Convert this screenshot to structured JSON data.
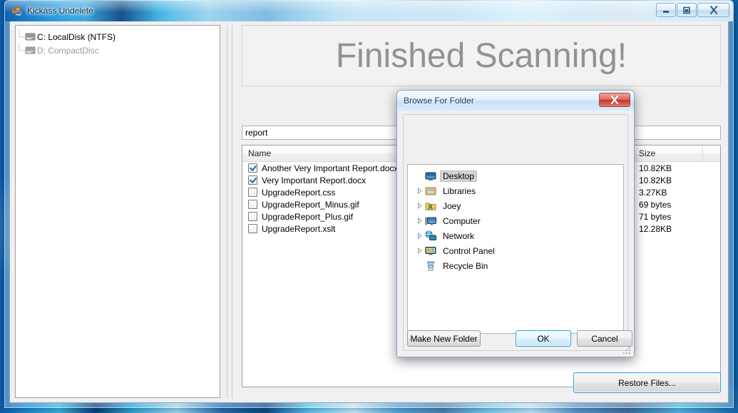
{
  "window": {
    "title": "Kickass Undelete",
    "icon": "app-icon",
    "minimize_label": "Minimize",
    "maximize_label": "Maximize",
    "close_label": "Close"
  },
  "drives": {
    "items": [
      {
        "label": "C: LocalDisk (NTFS)",
        "enabled": true
      },
      {
        "label": "D: CompactDisc",
        "enabled": false
      }
    ]
  },
  "banner": {
    "text": "Finished Scanning!"
  },
  "search": {
    "value": "report",
    "placeholder": ""
  },
  "filelist": {
    "columns": [
      "Name",
      "Size",
      ""
    ],
    "rows": [
      {
        "checked": true,
        "name": "Another Very Important Report.docx",
        "size": "10.82KB"
      },
      {
        "checked": true,
        "name": "Very Important Report.docx",
        "size": "10.82KB"
      },
      {
        "checked": false,
        "name": "UpgradeReport.css",
        "size": "3.27KB"
      },
      {
        "checked": false,
        "name": "UpgradeReport_Minus.gif",
        "size": "69 bytes"
      },
      {
        "checked": false,
        "name": "UpgradeReport_Plus.gif",
        "size": "71 bytes"
      },
      {
        "checked": false,
        "name": "UpgradeReport.xslt",
        "size": "12.28KB"
      }
    ]
  },
  "actions": {
    "restore_label": "Restore Files..."
  },
  "dialog": {
    "title": "Browse For Folder",
    "close_label": "Close",
    "tree": [
      {
        "label": "Desktop",
        "icon": "monitor-icon",
        "expandable": false,
        "selected": true,
        "indent": 0
      },
      {
        "label": "Libraries",
        "icon": "libraries-icon",
        "expandable": true,
        "selected": false,
        "indent": 1
      },
      {
        "label": "Joey",
        "icon": "user-folder-icon",
        "expandable": true,
        "selected": false,
        "indent": 1
      },
      {
        "label": "Computer",
        "icon": "computer-icon",
        "expandable": true,
        "selected": false,
        "indent": 1
      },
      {
        "label": "Network",
        "icon": "network-icon",
        "expandable": true,
        "selected": false,
        "indent": 1
      },
      {
        "label": "Control Panel",
        "icon": "control-panel-icon",
        "expandable": true,
        "selected": false,
        "indent": 1
      },
      {
        "label": "Recycle Bin",
        "icon": "recycle-bin-icon",
        "expandable": false,
        "selected": false,
        "indent": 1
      }
    ],
    "buttons": {
      "make_new_folder": "Make New Folder",
      "ok": "OK",
      "cancel": "Cancel"
    }
  },
  "colors": {
    "accent_blue": "#2a9fd6",
    "banner_text": "#929292",
    "titlebar_text": "#16304f",
    "close_red": "#c8342a",
    "disabled_text": "#9a9a9a"
  }
}
